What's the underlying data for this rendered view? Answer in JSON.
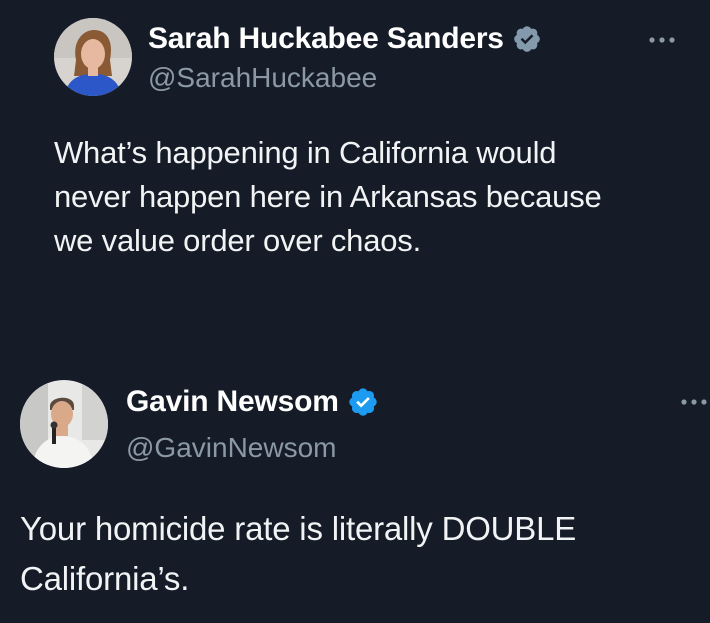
{
  "tweets": [
    {
      "display_name": "Sarah Huckabee Sanders",
      "handle": "@SarahHuckabee",
      "verified_badge": "gray-verified-badge-icon",
      "badge_color": "#829aab",
      "avatar_icon": "profile-photo-avatar",
      "more_icon": "more-options-icon",
      "text_lines": [
        "What’s happening in California would",
        "never happen here in Arkansas because",
        "we value order over chaos."
      ]
    },
    {
      "display_name": "Gavin Newsom",
      "handle": "@GavinNewsom",
      "verified_badge": "blue-verified-badge-icon",
      "badge_color": "#1d9bf0",
      "avatar_icon": "profile-photo-avatar",
      "more_icon": "more-options-icon",
      "text_lines": [
        "Your homicide rate is literally DOUBLE",
        "California’s."
      ]
    }
  ],
  "colors": {
    "background": "#151c28",
    "text_primary": "#ffffff",
    "text_secondary": "#8b98a5"
  }
}
